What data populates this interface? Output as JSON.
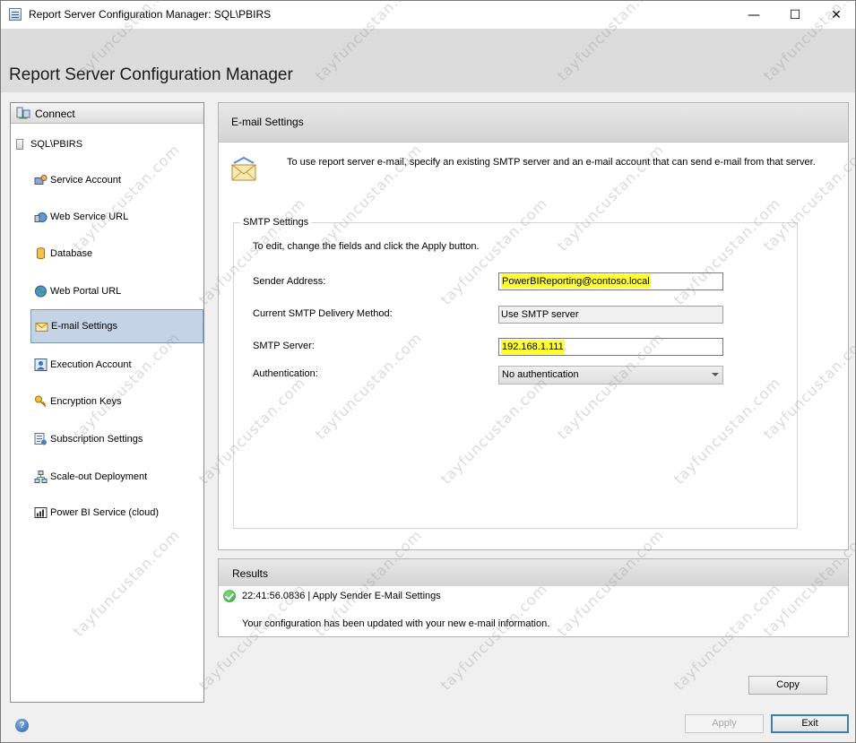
{
  "window": {
    "title": "Report Server Configuration Manager: SQL\\PBIRS",
    "minimize_glyph": "—",
    "maximize_glyph": "☐",
    "close_glyph": "✕"
  },
  "header": {
    "title": "Report Server Configuration Manager"
  },
  "sidebar": {
    "connect_label": "Connect",
    "server_label": "SQL\\PBIRS",
    "items": [
      {
        "label": "Service Account",
        "icon": "service-account-icon"
      },
      {
        "label": "Web Service URL",
        "icon": "web-service-url-icon"
      },
      {
        "label": "Database",
        "icon": "database-icon"
      },
      {
        "label": "Web Portal URL",
        "icon": "globe-icon"
      },
      {
        "label": "E-mail Settings",
        "icon": "email-icon"
      },
      {
        "label": "Execution Account",
        "icon": "execution-account-icon"
      },
      {
        "label": "Encryption Keys",
        "icon": "key-icon"
      },
      {
        "label": "Subscription Settings",
        "icon": "subscription-icon"
      },
      {
        "label": "Scale-out Deployment",
        "icon": "scale-out-icon"
      },
      {
        "label": "Power BI Service (cloud)",
        "icon": "power-bi-icon"
      }
    ],
    "active_index": 4
  },
  "panel": {
    "title": "E-mail Settings",
    "intro": "To use report server e-mail, specify an existing SMTP server and an e-mail account that can send e-mail from that server.",
    "smtp": {
      "legend": "SMTP Settings",
      "note": "To edit, change the fields and click the Apply button.",
      "sender_label": "Sender Address:",
      "sender_value": "PowerBIReporting@contoso.local",
      "method_label": "Current SMTP Delivery Method:",
      "method_value": "Use SMTP server",
      "server_label": "SMTP Server:",
      "server_value": "192.168.1.111",
      "auth_label": "Authentication:",
      "auth_value": "No authentication"
    }
  },
  "results": {
    "title": "Results",
    "line1": "22:41:56.0836 | Apply Sender E-Mail Settings",
    "line2": "Your configuration has been updated with your new e-mail information."
  },
  "buttons": {
    "copy": "Copy",
    "apply": "Apply",
    "exit": "Exit"
  },
  "help": {
    "glyph": "?"
  },
  "watermark": "tayfuncustan.com",
  "colors": {
    "highlight": "#ffff33",
    "active_nav": "#c5d3e6",
    "header_bg": "#dcdcdc"
  }
}
